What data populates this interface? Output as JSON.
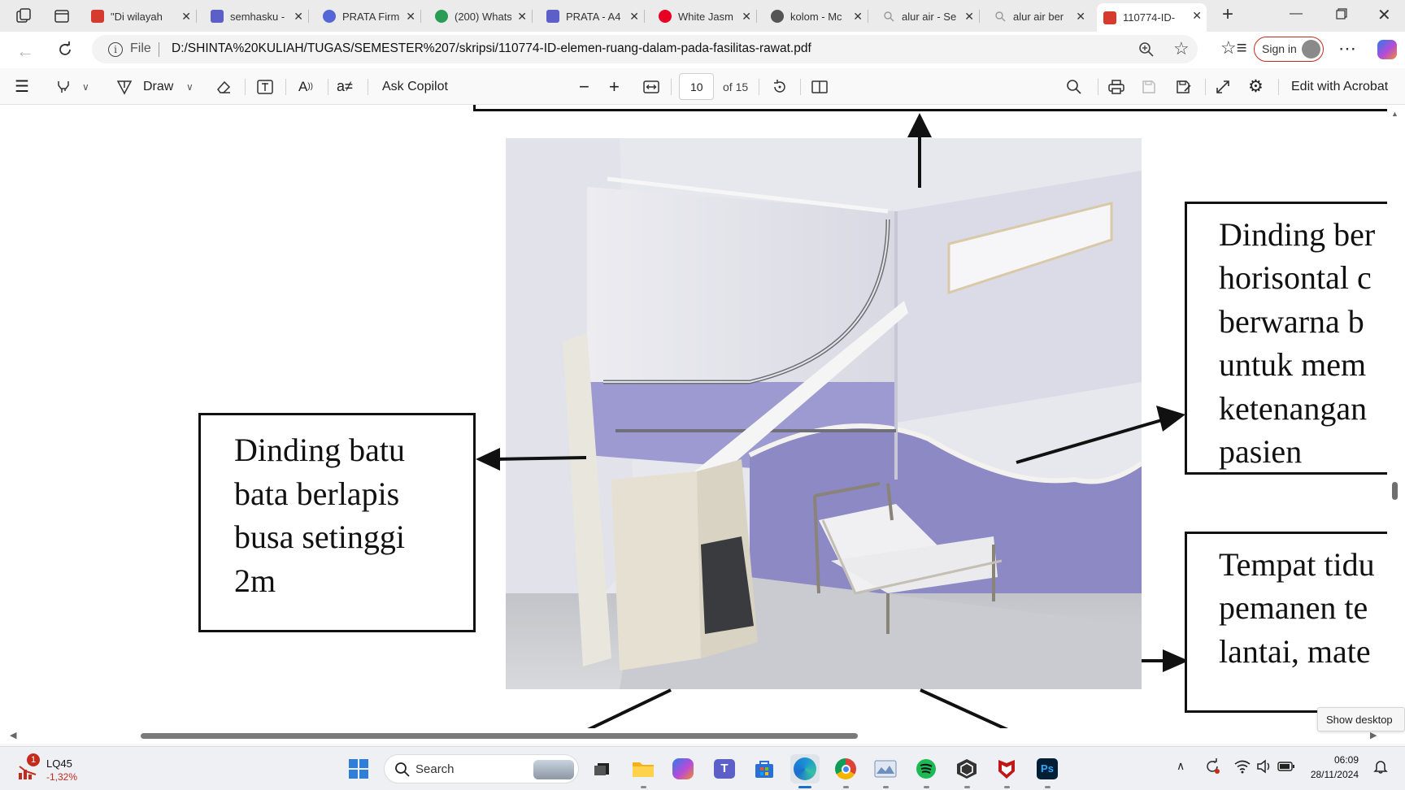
{
  "browser": {
    "tabs": [
      {
        "title": "\"Di wilayah",
        "icon": "pdf-icon",
        "color": "#d63a2f"
      },
      {
        "title": "semhasku -",
        "icon": "printer-icon",
        "color": "#5b5fc7"
      },
      {
        "title": "PRATA Firm",
        "icon": "canva-icon",
        "color": "#5566d6"
      },
      {
        "title": "(200) Whats",
        "icon": "whatsapp-icon",
        "color": "#2a9d55"
      },
      {
        "title": "PRATA - A4",
        "icon": "printer-icon",
        "color": "#5b5fc7"
      },
      {
        "title": "White Jasm",
        "icon": "pinterest-icon",
        "color": "#e60023"
      },
      {
        "title": "kolom - Mc",
        "icon": "chatgpt-icon",
        "color": "#555555"
      },
      {
        "title": "alur air - Se",
        "icon": "search-icon",
        "color": "#999999"
      },
      {
        "title": "alur air ber",
        "icon": "search-icon",
        "color": "#999999"
      },
      {
        "title": "110774-ID-",
        "icon": "pdf-icon",
        "color": "#d63a2f",
        "active": true
      }
    ],
    "address": {
      "scheme_label": "File",
      "url": "D:/SHINTA%20KULIAH/TUGAS/SEMESTER%207/skripsi/110774-ID-elemen-ruang-dalam-pada-fasilitas-rawat.pdf"
    },
    "sign_in_label": "Sign in"
  },
  "pdf_toolbar": {
    "draw_label": "Draw",
    "copilot_label": "Ask Copilot",
    "page_number": "10",
    "page_total": "of 15",
    "acrobat_label": "Edit with Acrobat"
  },
  "document": {
    "left_box_lines": [
      "Dinding batu",
      "bata berlapis",
      "busa setinggi",
      "2m"
    ],
    "right_box1_lines": [
      "Dinding ber",
      "horisontal c",
      "berwarna b",
      "untuk mem",
      "ketenangan",
      "pasien"
    ],
    "right_box2_lines": [
      "Tempat tidu",
      "pemanen te",
      "lantai, mate"
    ]
  },
  "tooltip": "Show desktop",
  "taskbar": {
    "stock_name": "LQ45",
    "stock_change": "-1,32%",
    "stock_badge": "1",
    "search_placeholder": "Search",
    "time": "06:09",
    "date": "28/11/2024"
  },
  "colors": {
    "accent_red": "#c42b1c",
    "wall_lavender": "#8c89c4",
    "stock_negative": "#c42b1c"
  }
}
